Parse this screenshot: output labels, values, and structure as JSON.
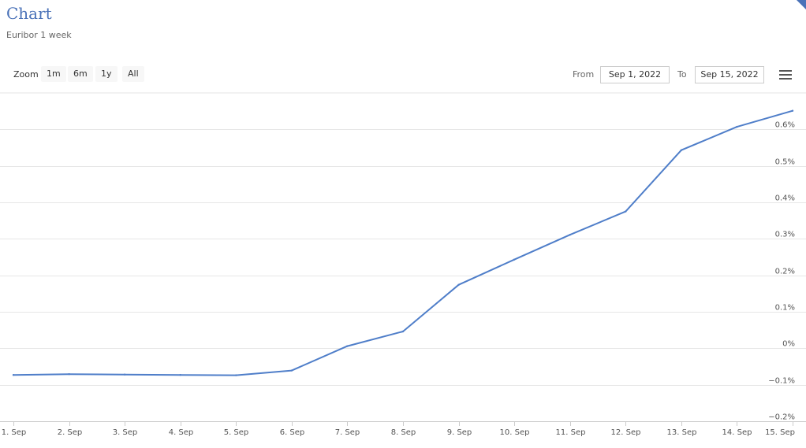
{
  "header": {
    "title": "Chart",
    "subtitle": "Euribor 1 week"
  },
  "toolbar": {
    "zoom_label": "Zoom",
    "zoom_buttons": [
      "1m",
      "6m",
      "1y",
      "All"
    ],
    "from_label": "From",
    "from_value": "Sep 1, 2022",
    "to_label": "To",
    "to_value": "Sep 15, 2022",
    "menu_icon": "hamburger-menu-icon"
  },
  "chart_data": {
    "type": "line",
    "title": "Chart",
    "subtitle": "Euribor 1 week",
    "x": [
      1,
      2,
      3,
      4,
      5,
      6,
      7,
      8,
      9,
      10,
      11,
      12,
      13,
      14,
      15
    ],
    "x_tick_labels": [
      "1. Sep",
      "2. Sep",
      "3. Sep",
      "4. Sep",
      "5. Sep",
      "6. Sep",
      "7. Sep",
      "8. Sep",
      "9. Sep",
      "10. Sep",
      "11. Sep",
      "12. Sep",
      "13. Sep",
      "14. Sep",
      "15. Sep"
    ],
    "series": [
      {
        "values": [
          -0.073,
          -0.071,
          -0.072,
          -0.073,
          -0.074,
          -0.061,
          0.006,
          0.046,
          0.174,
          0.243,
          0.311,
          0.375,
          0.543,
          0.607,
          0.651
        ],
        "color": "#4f7ec9"
      }
    ],
    "y_ticks": [
      -0.2,
      -0.1,
      0,
      0.1,
      0.2,
      0.3,
      0.4,
      0.5,
      0.6
    ],
    "y_tick_labels": [
      "−0.2%",
      "−0.1%",
      "0%",
      "0.1%",
      "0.2%",
      "0.3%",
      "0.4%",
      "0.5%",
      "0.6%"
    ],
    "ylim": [
      -0.2,
      0.7
    ],
    "yaxis_position": "right",
    "grid": true,
    "legend": "none"
  }
}
